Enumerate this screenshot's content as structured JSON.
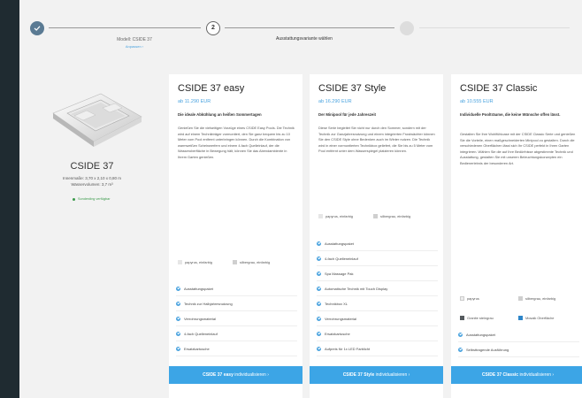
{
  "stepper": {
    "step1_label": "Modell: CSIDE 37",
    "step1_link": "Anpassen ›",
    "step2_number": "2",
    "step2_label": "Ausstattungsvariante wählen"
  },
  "model": {
    "name": "CSIDE 37",
    "dimensions": "Innenmaße: 3,70 x 2,10 x 0,80 m",
    "volume": "Wasservolumen: 3,7 m³",
    "availability": "Sonderding verfügbar"
  },
  "cards": [
    {
      "title": "CSIDE 37 easy",
      "price": "ab 11.290 EUR",
      "subtitle": "Die ideale Abkühlung an heißen Sommertagen",
      "description": "Genießen Sie die vielseitigen Vorzüge eines CSIDE Easy Pools. Die Technik wird auf einem Technikträger vormontiert, den Sie ganz bequem bis zu 10 Meter vom Pool entfernt unterbringen können. Durch die Kombination von warmweißen Scheinwerfern und einem 4-fach Quelleinlauf, der die Wasseroberfläche in Bewegung hält, können Sie das Abendambiente in Ihrem Garten genießen.",
      "swatches": [
        {
          "label": "papyrus, einfarbig",
          "color": "#e6e6e6"
        },
        {
          "label": "silbergrau, einfarbig",
          "color": "#cfcfcf"
        }
      ],
      "features": [
        "Ausstattungspaket",
        "Technik zur Halbjahresnutzung",
        "Verrohrungsmaterial",
        "4-fach Quelleneinlauf",
        "Ersatzkartusche"
      ],
      "cta_model": "CSIDE 37 easy",
      "cta_action": "individualisieren",
      "cta_arrow": "›"
    },
    {
      "title": "CSIDE 37 Style",
      "price": "ab 16.290 EUR",
      "subtitle": "Der Minipool für jede Jahreszeit",
      "description": "Diese Serie begleitet Sie nicht nur durch den Sommer, sondern mit der Technik zur Ganzjahresnutzung und einem integrierten Frostwächter können Sie den CSIDE Style ohne Bedenken auch im Winter nutzen. Die Technik wird in einer vormontierten Technikbox geliefert, die Sie bis zu 5 Meter vom Pool entfernt unter dem Wasserspiegel platzieren können.",
      "swatches": [
        {
          "label": "papyrus, einfarbig",
          "color": "#e6e6e6"
        },
        {
          "label": "silbergrau, einfarbig",
          "color": "#cfcfcf"
        }
      ],
      "features": [
        "Ausstattungspaket",
        "4-fach Quelleneinlauf",
        "Spa Massage Pak",
        "Automatische Technik mit Touch Display",
        "Technikbox XL",
        "Verrohrungsmaterial",
        "Ersatzkartusche",
        "Aufpreis für 1x LED Farblicht"
      ],
      "cta_model": "CSIDE 37 Style",
      "cta_action": "individualisieren",
      "cta_arrow": "›"
    },
    {
      "title": "CSIDE 37 Classic",
      "price": "ab 10.555 EUR",
      "subtitle": "Individuelle Poolträume, die keine Wünsche offen lässt.",
      "description": "Gestalten Sie Ihre Wohlfühloase mit der CSIDE Classic Serie und genießen Sie die Vorteile, einen maßgeschneiderten Minipool zu gestalten. Durch die verschiedenen Oberflächen lässt sich Ihr CSIDE perfekt in Ihren Garten integrieren. Wählen Sie die auf Ihre Bedürfnisse abgestimmte Technik und Ausstattung, gestalten Sie mit unseren Beleuchtungskonzepten ein Bedienerlebnis der besonderen Art.",
      "swatches": [
        {
          "label": "papyrus",
          "color": "#ededed"
        },
        {
          "label": "silbergrau, einfarbig",
          "color": "#cfcfcf"
        },
        {
          "label": "Granite steingrau",
          "color": "#555a5e"
        },
        {
          "label": "Mosaik Oberfläche",
          "color": "#2e86c9"
        }
      ],
      "features": [
        "Ausstattungspaket",
        "Selbsttragende Ausführung"
      ],
      "cta_model": "CSIDE 37 Classic",
      "cta_action": "individualisieren",
      "cta_arrow": "›"
    }
  ]
}
